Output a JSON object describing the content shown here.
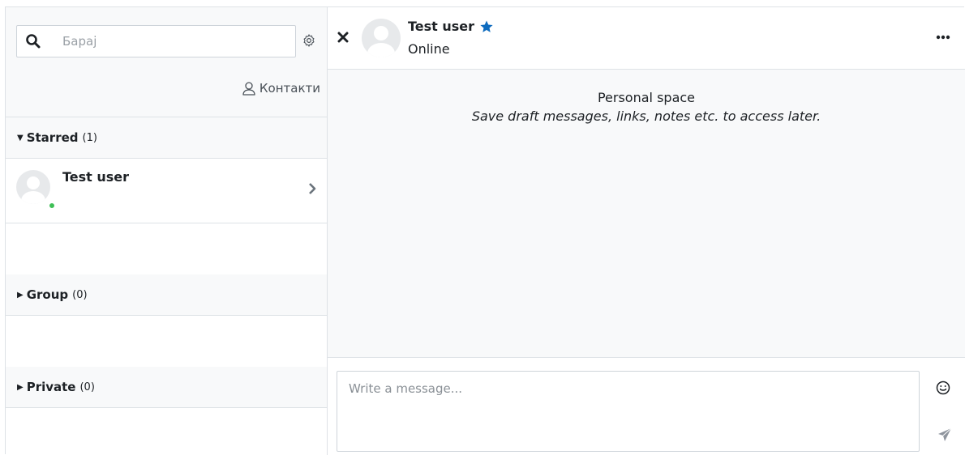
{
  "search": {
    "placeholder": "Барај"
  },
  "contacts": {
    "label": "Контакти"
  },
  "sections": {
    "starred": {
      "title": "Starred",
      "count": "(1)",
      "caret": "▼"
    },
    "group": {
      "title": "Group",
      "count": "(0)",
      "caret": "▶"
    },
    "private": {
      "title": "Private",
      "count": "(0)",
      "caret": "▶"
    }
  },
  "starred_conversations": [
    {
      "name": "Test user",
      "online": true
    }
  ],
  "conversation": {
    "name": "Test user",
    "status": "Online",
    "starred": true,
    "personal_space_title": "Personal space",
    "personal_space_description": "Save draft messages, links, notes etc. to access later."
  },
  "composer": {
    "placeholder": "Write a message..."
  },
  "colors": {
    "star": "#0f6cbf",
    "online": "#3fbf56",
    "panel_bg": "#f8f9fa",
    "border": "#dee2e6"
  },
  "icons": [
    "search-icon",
    "gear-icon",
    "user-outline-icon",
    "chevron-right-icon",
    "close-icon",
    "star-icon",
    "more-icon",
    "emoji-icon",
    "send-icon"
  ]
}
